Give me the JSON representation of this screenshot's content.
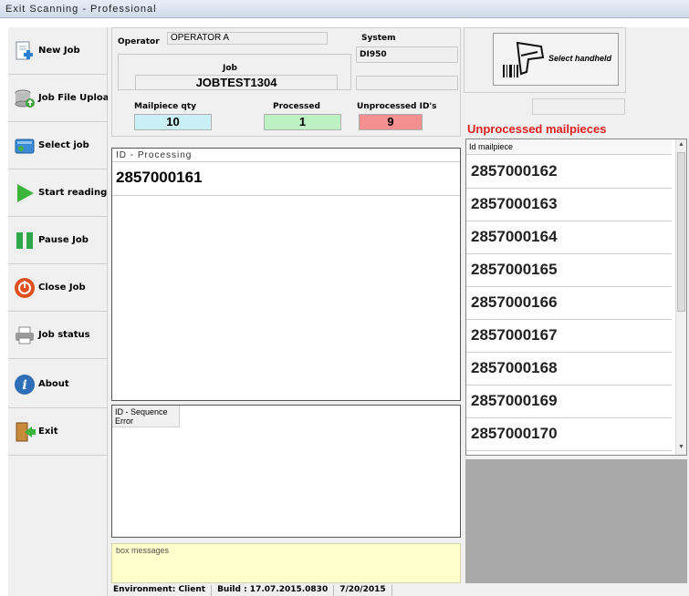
{
  "window": {
    "title": "Exit Scanning - Professional"
  },
  "sidebar": {
    "items": [
      {
        "label": "New Job",
        "icon": "new-job-icon"
      },
      {
        "label": "Job File Upload",
        "icon": "database-upload-icon"
      },
      {
        "label": "Select job",
        "icon": "select-job-icon"
      },
      {
        "label": "Start reading",
        "icon": "play-icon"
      },
      {
        "label": "Pause Job",
        "icon": "pause-icon"
      },
      {
        "label": "Close Job",
        "icon": "power-icon"
      },
      {
        "label": "Job status",
        "icon": "printer-icon"
      },
      {
        "label": "About",
        "icon": "info-icon"
      },
      {
        "label": "Exit",
        "icon": "exit-door-icon"
      }
    ]
  },
  "header": {
    "operator_label": "Operator",
    "operator_value": "OPERATOR A",
    "system_label": "System",
    "system_value": "DI950",
    "job_label": "Job",
    "job_value": "JOBTEST1304",
    "mailpiece_qty_label": "Mailpiece qty",
    "mailpiece_qty_value": "10",
    "processed_label": "Processed",
    "processed_value": "1",
    "unprocessed_label": "Unprocessed ID's",
    "unprocessed_value": "9"
  },
  "processing": {
    "caption": "ID - Processing",
    "current_id": "2857000161"
  },
  "sequence_error": {
    "header_line1": "ID - Sequence",
    "header_line2": "Error"
  },
  "messages": {
    "caption": "box messages"
  },
  "handheld": {
    "button_label": "Select handheld",
    "icon": "barcode-scanner-icon"
  },
  "unprocessed": {
    "title": "Unprocessed mailpieces",
    "column_header": "Id mailpiece",
    "ids": [
      "2857000162",
      "2857000163",
      "2857000164",
      "2857000165",
      "2857000166",
      "2857000167",
      "2857000168",
      "2857000169",
      "2857000170"
    ]
  },
  "status_bar": {
    "environment": "Environment: Client",
    "build": "Build : 17.07.2015.0830",
    "date": "7/20/2015"
  },
  "colors": {
    "qty_bg": "#c9f1f5",
    "processed_bg": "#bdf0c2",
    "unprocessed_bg": "#f58f90",
    "alert_red": "#e02020",
    "messages_bg": "#ffffcc",
    "empty_gray": "#a9a9a9"
  }
}
